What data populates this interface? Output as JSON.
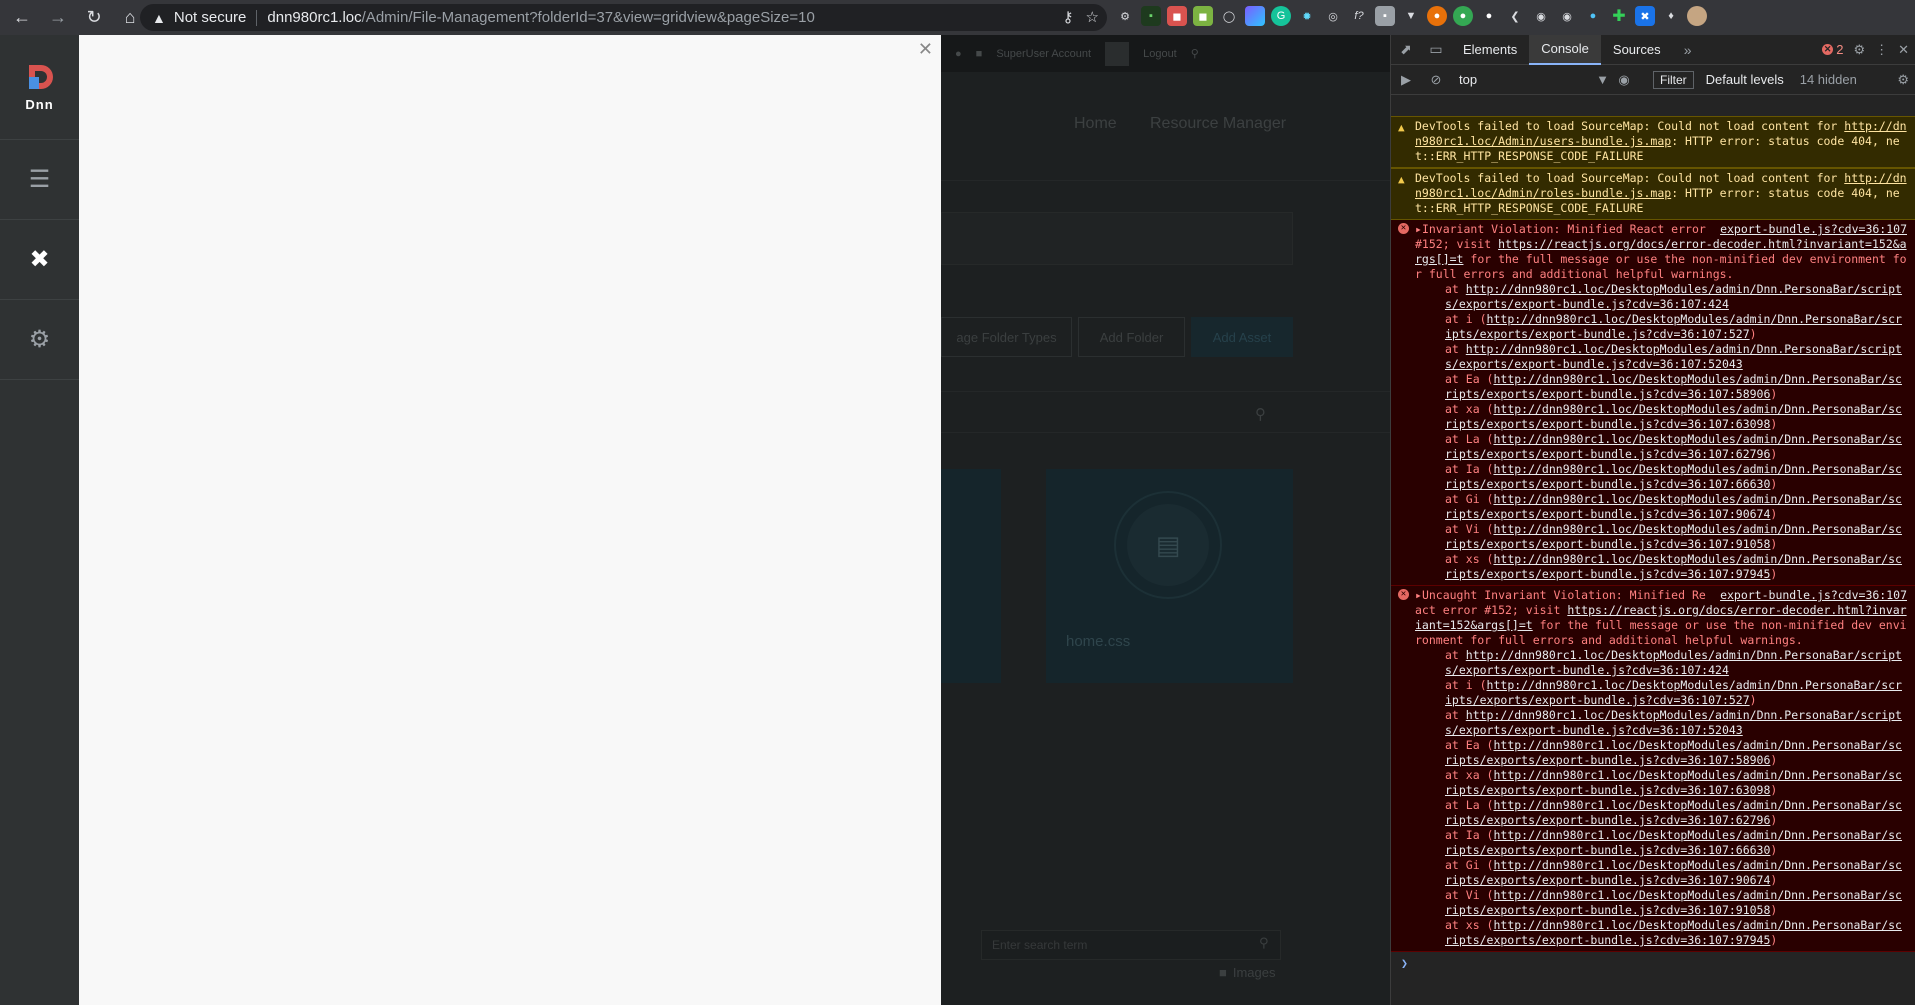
{
  "browser": {
    "security_label": "Not secure",
    "url_host": "dnn980rc1.loc",
    "url_path": "/Admin/File-Management?folderId=37&view=gridview&pageSize=10"
  },
  "persona_bar": {
    "logo_text": "Dnn"
  },
  "background_page": {
    "control_bar": {
      "account": "SuperUser Account",
      "logout": "Logout"
    },
    "nav": [
      "Home",
      "Resource Manager"
    ],
    "buttons": {
      "folder_types": "age Folder Types",
      "add_folder": "Add Folder",
      "add_asset": "Add Asset"
    },
    "card_label": "home.css",
    "search_placeholder": "Enter search term",
    "folder_label": "Images"
  },
  "devtools": {
    "tabs": [
      "Elements",
      "Console",
      "Sources"
    ],
    "active_tab": "Console",
    "error_count": "2",
    "context": "top",
    "filter_label": "Filter",
    "levels_label": "Default levels",
    "hidden_label": "14 hidden",
    "warnings": [
      {
        "prefix": "DevTools failed to load SourceMap: Could not load content for ",
        "link": "http://dnn980rc1.loc/Admin/users-bundle.js.map",
        "suffix": ": HTTP error: status code 404, net::ERR_HTTP_RESPONSE_CODE_FAILURE"
      },
      {
        "prefix": "DevTools failed to load SourceMap: Could not load content for ",
        "link": "http://dnn980rc1.loc/Admin/roles-bundle.js.map",
        "suffix": ": HTTP error: status code 404, net::ERR_HTTP_RESPONSE_CODE_FAILURE"
      }
    ],
    "errors": [
      {
        "source": "export-bundle.js?cdv=36:107",
        "head": "Invariant Violation: Minified React error #152; visit ",
        "link": "https://reactjs.org/docs/error-decoder.html?invariant=152&args[]=t",
        "tail": " for the full message or use the non-minified dev environment for full errors and additional helpful warnings.",
        "stack": [
          {
            "fn": "",
            "url": "http://dnn980rc1.loc/DesktopModules/admin/Dnn.PersonaBar/scripts/exports/export-bundle.js?cdv=36:107:424"
          },
          {
            "fn": "i",
            "url": "http://dnn980rc1.loc/DesktopModules/admin/Dnn.PersonaBar/scripts/exports/export-bundle.js?cdv=36:107:527"
          },
          {
            "fn": "",
            "url": "http://dnn980rc1.loc/DesktopModules/admin/Dnn.PersonaBar/scripts/exports/export-bundle.js?cdv=36:107:52043"
          },
          {
            "fn": "Ea",
            "url": "http://dnn980rc1.loc/DesktopModules/admin/Dnn.PersonaBar/scripts/exports/export-bundle.js?cdv=36:107:58906"
          },
          {
            "fn": "xa",
            "url": "http://dnn980rc1.loc/DesktopModules/admin/Dnn.PersonaBar/scripts/exports/export-bundle.js?cdv=36:107:63098"
          },
          {
            "fn": "La",
            "url": "http://dnn980rc1.loc/DesktopModules/admin/Dnn.PersonaBar/scripts/exports/export-bundle.js?cdv=36:107:62796"
          },
          {
            "fn": "Ia",
            "url": "http://dnn980rc1.loc/DesktopModules/admin/Dnn.PersonaBar/scripts/exports/export-bundle.js?cdv=36:107:66630"
          },
          {
            "fn": "Gi",
            "url": "http://dnn980rc1.loc/DesktopModules/admin/Dnn.PersonaBar/scripts/exports/export-bundle.js?cdv=36:107:90674"
          },
          {
            "fn": "Vi",
            "url": "http://dnn980rc1.loc/DesktopModules/admin/Dnn.PersonaBar/scripts/exports/export-bundle.js?cdv=36:107:91058"
          },
          {
            "fn": "xs",
            "url": "http://dnn980rc1.loc/DesktopModules/admin/Dnn.PersonaBar/scripts/exports/export-bundle.js?cdv=36:107:97945"
          }
        ]
      },
      {
        "source": "export-bundle.js?cdv=36:107",
        "head": "Uncaught Invariant Violation: Minified React error #152; visit ",
        "link": "https://reactjs.org/docs/error-decoder.html?invariant=152&args[]=t",
        "tail": " for the full message or use the non-minified dev environment for full errors and additional helpful warnings.",
        "stack": [
          {
            "fn": "",
            "url": "http://dnn980rc1.loc/DesktopModules/admin/Dnn.PersonaBar/scripts/exports/export-bundle.js?cdv=36:107:424"
          },
          {
            "fn": "i",
            "url": "http://dnn980rc1.loc/DesktopModules/admin/Dnn.PersonaBar/scripts/exports/export-bundle.js?cdv=36:107:527"
          },
          {
            "fn": "",
            "url": "http://dnn980rc1.loc/DesktopModules/admin/Dnn.PersonaBar/scripts/exports/export-bundle.js?cdv=36:107:52043"
          },
          {
            "fn": "Ea",
            "url": "http://dnn980rc1.loc/DesktopModules/admin/Dnn.PersonaBar/scripts/exports/export-bundle.js?cdv=36:107:58906"
          },
          {
            "fn": "xa",
            "url": "http://dnn980rc1.loc/DesktopModules/admin/Dnn.PersonaBar/scripts/exports/export-bundle.js?cdv=36:107:63098"
          },
          {
            "fn": "La",
            "url": "http://dnn980rc1.loc/DesktopModules/admin/Dnn.PersonaBar/scripts/exports/export-bundle.js?cdv=36:107:62796"
          },
          {
            "fn": "Ia",
            "url": "http://dnn980rc1.loc/DesktopModules/admin/Dnn.PersonaBar/scripts/exports/export-bundle.js?cdv=36:107:66630"
          },
          {
            "fn": "Gi",
            "url": "http://dnn980rc1.loc/DesktopModules/admin/Dnn.PersonaBar/scripts/exports/export-bundle.js?cdv=36:107:90674"
          },
          {
            "fn": "Vi",
            "url": "http://dnn980rc1.loc/DesktopModules/admin/Dnn.PersonaBar/scripts/exports/export-bundle.js?cdv=36:107:91058"
          },
          {
            "fn": "xs",
            "url": "http://dnn980rc1.loc/DesktopModules/admin/Dnn.PersonaBar/scripts/exports/export-bundle.js?cdv=36:107:97945"
          }
        ]
      }
    ]
  }
}
